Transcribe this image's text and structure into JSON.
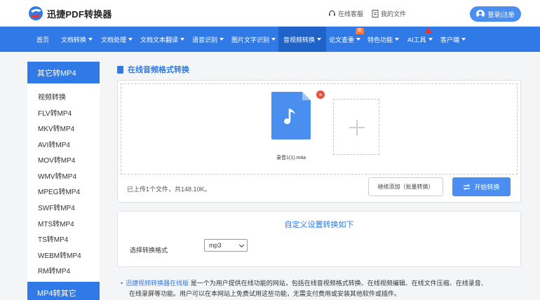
{
  "header": {
    "logo_text": "迅捷PDF转换器",
    "support_label": "在线客服",
    "my_files_label": "我的文件",
    "login_label": "登录|注册"
  },
  "nav": {
    "items": [
      {
        "label": "首页",
        "dropdown": false
      },
      {
        "label": "文档转换",
        "dropdown": true
      },
      {
        "label": "文档处理",
        "dropdown": true
      },
      {
        "label": "文档文本翻译",
        "dropdown": true
      },
      {
        "label": "语音识别",
        "dropdown": true
      },
      {
        "label": "图片文字识别",
        "dropdown": true
      },
      {
        "label": "音视频转换",
        "dropdown": true
      },
      {
        "label": "论文查重",
        "dropdown": true
      },
      {
        "label": "特色功能",
        "dropdown": true
      },
      {
        "label": "AI工具",
        "dropdown": true
      },
      {
        "label": "客户端",
        "dropdown": true
      }
    ],
    "active_index": 6,
    "new_badge": "新"
  },
  "sidebar": {
    "section1_title": "其它转MP4",
    "items": [
      "视频转换",
      "FLV转MP4",
      "MKV转MP4",
      "AVI转MP4",
      "MOV转MP4",
      "WMV转MP4",
      "MPEG转MP4",
      "SWF转MP4",
      "MTS转MP4",
      "TS转MP4",
      "WEBM转MP4",
      "RM转MP4"
    ],
    "section2_title": "MP4转其它"
  },
  "main": {
    "title": "在线音频格式转换",
    "file_name": "录音1(1).m4a",
    "upload_status": "已上传1个文件，共148.10K。",
    "continue_label": "继续添加（批量转换）",
    "start_label": "开始转换",
    "settings_title": "自定义设置转换如下",
    "format_label": "选择转换格式",
    "format_value": "mp3",
    "desc_link": "迅捷视频转换器在线版",
    "desc_text1": "是一个为用户提供在线功能的网站，包括在线音视频格式转换、在线视频编辑、在线文件压缩、在线录音、",
    "desc_text2": "在线录屏等功能。用户可以在本网站上免费试用这些功能，无需支付费用或安装其他软件或插件。"
  },
  "colors": {
    "primary": "#2f7ae6",
    "button": "#4a8ff0",
    "remove": "#e8513f",
    "arrow": "#e8352e"
  }
}
